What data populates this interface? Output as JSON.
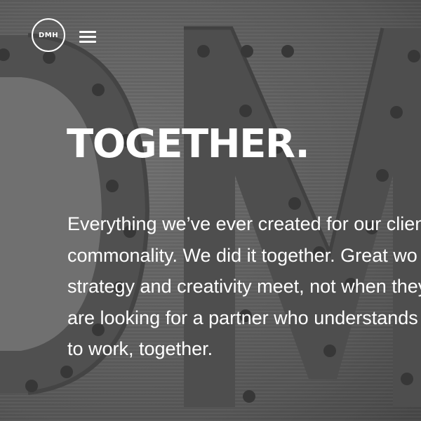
{
  "header": {
    "logo_text": "DMH",
    "menu_icon": "hamburger-menu-icon"
  },
  "hero": {
    "background_image": "letters-d-m-marquee-icon",
    "headline": "TOGETHER.",
    "body_lines": [
      "Everything we’ve ever created for our client",
      "commonality. We did it together. Great wo",
      "strategy and creativity meet, not when they",
      "are looking for a partner who understands t",
      "to work, together."
    ]
  },
  "colors": {
    "text": "#ffffff",
    "background": "#6b6b6b"
  }
}
